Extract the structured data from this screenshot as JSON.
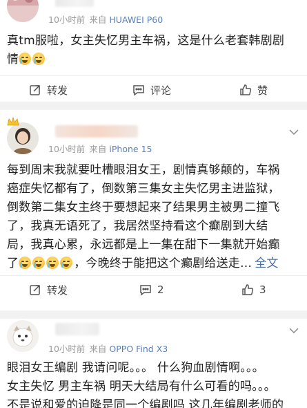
{
  "posts": [
    {
      "time": "10小时前",
      "source_prefix": "来自",
      "device": "HUAWEI P60",
      "lines": [
        "真tm服啦，女主失忆男主车祸，这是什么老套韩剧剧",
        "情"
      ],
      "actions": {
        "repost": "转发",
        "comment": "评论",
        "like": "赞"
      }
    },
    {
      "time": "10小时前",
      "source_prefix": "来自",
      "device": "iPhone 15",
      "lines": [
        "每到周末我就要吐槽眼泪女王，剧情真够颠的，车祸",
        "癌症失忆都有了，倒数第三集女主失忆男主进监狱，",
        "倒数第二集女主终于要想起来了结果男主被男二撞飞",
        "了，我真无语死了，我居然坚持看这个癫剧到大结",
        "局，我真心累，永远都是上一集在甜下一集就开始癫",
        "了",
        "，今晚终于能把这个癫剧给送走…"
      ],
      "more": "全文",
      "actions": {
        "repost": "转发",
        "comment": "2",
        "like": "3"
      }
    },
    {
      "time": "10小时前",
      "source_prefix": "来自",
      "device": "OPPO Find X3",
      "lines": [
        "眼泪女王编剧 我请问呢。。。 什么狗血剧情啊。。。",
        "女主失忆 男主车祸 明天大结局有什么可看的吗。。。",
        "不是说和爱的迫降是同一个编剧吗 这几年编剧老师的"
      ]
    }
  ],
  "colors": {
    "device_link": "#5b7fb8",
    "more_link": "#4a6fa8",
    "text": "#222222",
    "meta": "#9a9a9a"
  },
  "icons": [
    "repost-icon",
    "comment-icon",
    "like-icon",
    "chevron-down-icon"
  ]
}
